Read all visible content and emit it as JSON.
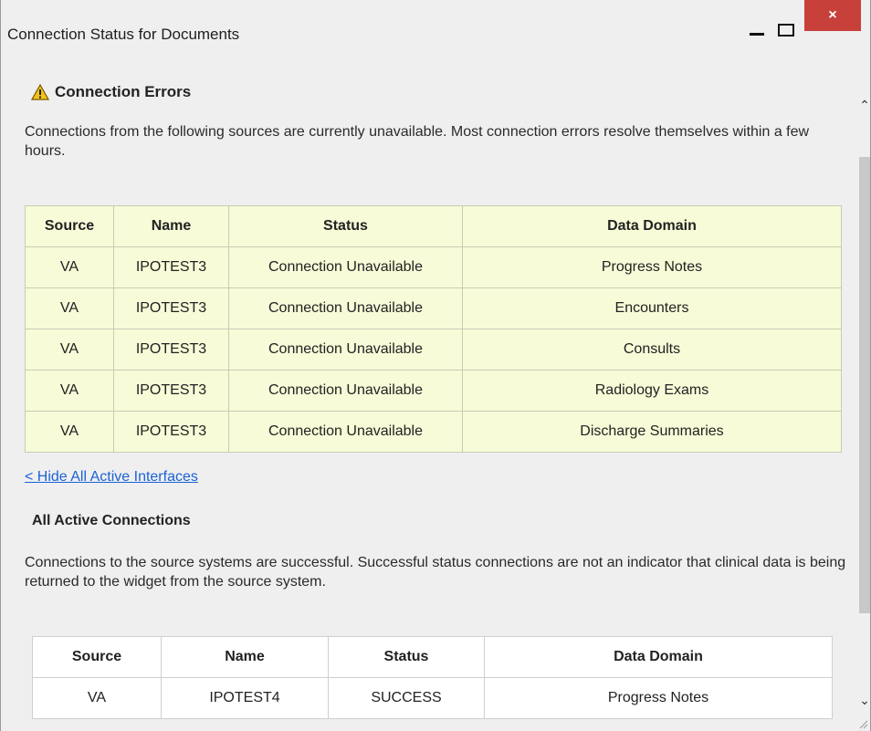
{
  "window": {
    "title": "Connection Status for Documents",
    "close_label": "×"
  },
  "errors_section": {
    "title": "Connection Errors",
    "description": "Connections from the following sources are currently unavailable. Most connection errors resolve themselves within a few hours.",
    "columns": [
      "Source",
      "Name",
      "Status",
      "Data Domain"
    ],
    "rows": [
      [
        "VA",
        "IPOTEST3",
        "Connection Unavailable",
        "Progress Notes"
      ],
      [
        "VA",
        "IPOTEST3",
        "Connection Unavailable",
        "Encounters"
      ],
      [
        "VA",
        "IPOTEST3",
        "Connection Unavailable",
        "Consults"
      ],
      [
        "VA",
        "IPOTEST3",
        "Connection Unavailable",
        "Radiology Exams"
      ],
      [
        "VA",
        "IPOTEST3",
        "Connection Unavailable",
        "Discharge Summaries"
      ]
    ]
  },
  "hide_link": "< Hide All Active Interfaces",
  "active_section": {
    "title": "All Active Connections",
    "description": "Connections to the source systems are successful. Successful status connections are not an indicator that clinical data is being returned to the widget from the source system.",
    "columns": [
      "Source",
      "Name",
      "Status",
      "Data Domain"
    ],
    "rows": [
      [
        "VA",
        "IPOTEST4",
        "SUCCESS",
        "Progress Notes"
      ]
    ]
  },
  "colors": {
    "error_table_bg": "#f7fbd7",
    "link": "#1a62d6",
    "close_button": "#c7413a",
    "warning_icon": "#f2c318"
  },
  "icons": {
    "warning": "warning-triangle-icon",
    "minimize": "minimize-icon",
    "maximize": "maximize-icon",
    "close": "close-icon"
  }
}
